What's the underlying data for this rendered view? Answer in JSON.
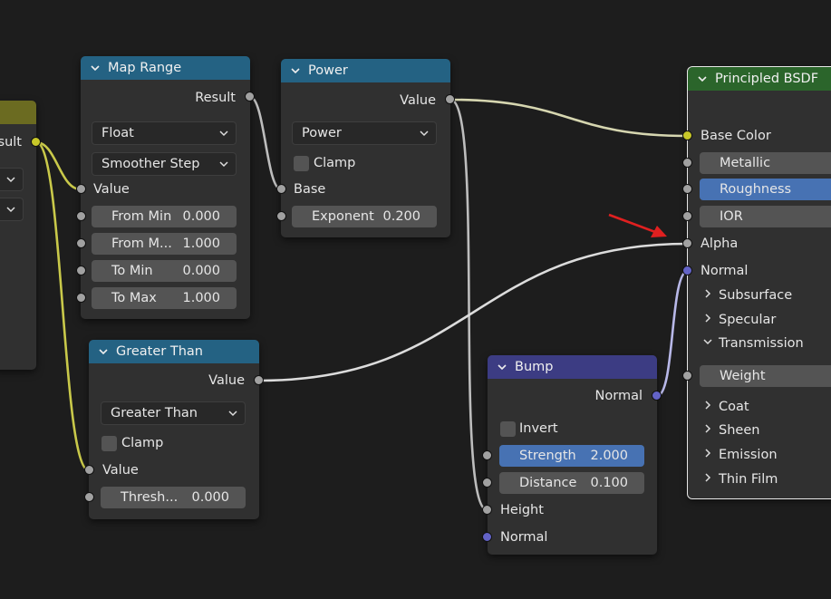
{
  "colors": {
    "background": "#1d1d1d",
    "node_body": "#303030",
    "header_converter": "#246283",
    "header_shader": "#2b652b",
    "header_vector": "#3c3c83",
    "header_input": "#6b6b21",
    "socket_float": "#a1a1a1",
    "socket_color": "#c7c729",
    "socket_vector": "#6363c7",
    "field_active": "#4772b3",
    "annotation_arrow": "#e02020"
  },
  "left_node": {
    "output_label": "esult"
  },
  "map_range": {
    "title": "Map Range",
    "output": "Result",
    "data_type": "Float",
    "interpolation": "Smoother Step",
    "input_value": "Value",
    "from_min": {
      "label": "From Min",
      "value": "0.000"
    },
    "from_max": {
      "label": "From M...",
      "value": "1.000"
    },
    "to_min": {
      "label": "To Min",
      "value": "0.000"
    },
    "to_max": {
      "label": "To Max",
      "value": "1.000"
    }
  },
  "power": {
    "title": "Power",
    "output": "Value",
    "operation": "Power",
    "clamp": "Clamp",
    "base": "Base",
    "exponent": {
      "label": "Exponent",
      "value": "0.200"
    }
  },
  "greater_than": {
    "title": "Greater Than",
    "output": "Value",
    "operation": "Greater Than",
    "clamp": "Clamp",
    "input_value": "Value",
    "threshold": {
      "label": "Thresh...",
      "value": "0.000"
    }
  },
  "bump": {
    "title": "Bump",
    "output": "Normal",
    "invert": "Invert",
    "strength": {
      "label": "Strength",
      "value": "2.000"
    },
    "distance": {
      "label": "Distance",
      "value": "0.100"
    },
    "height": "Height",
    "normal_in": "Normal"
  },
  "principled": {
    "title": "Principled BSDF",
    "base_color": "Base Color",
    "metallic": "Metallic",
    "roughness": "Roughness",
    "ior": "IOR",
    "alpha": "Alpha",
    "normal": "Normal",
    "panels": {
      "subsurface": "Subsurface",
      "specular": "Specular",
      "transmission": "Transmission",
      "coat": "Coat",
      "sheen": "Sheen",
      "emission": "Emission",
      "thin_film": "Thin Film"
    },
    "weight": "Weight"
  }
}
